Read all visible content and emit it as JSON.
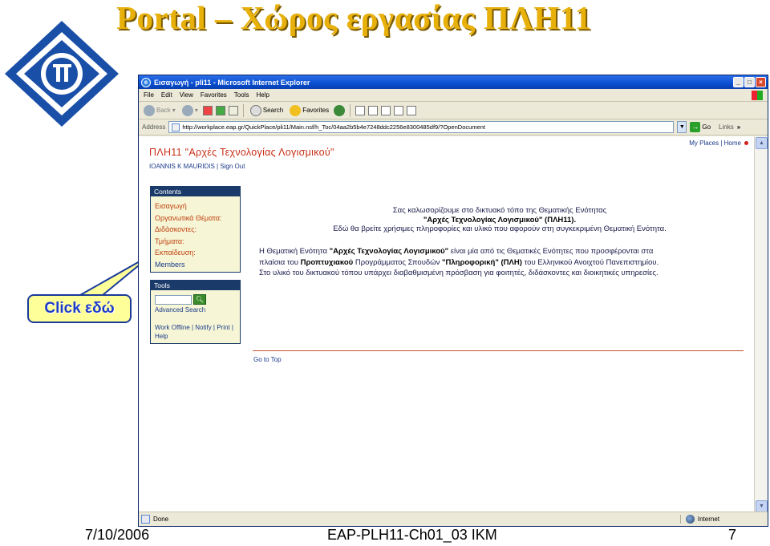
{
  "slide": {
    "title": "Portal – Χώρος εργασίας ΠΛΗ11",
    "callout": "Click εδώ",
    "footer_date": "7/10/2006",
    "footer_center": "EAP-PLH11-Ch01_03 IKM",
    "footer_page": "7"
  },
  "browser": {
    "window_title": "Εισαγωγή - pli11 - Microsoft Internet Explorer",
    "menu": [
      "File",
      "Edit",
      "View",
      "Favorites",
      "Tools",
      "Help"
    ],
    "toolbar": {
      "back": "Back",
      "search": "Search",
      "favorites": "Favorites"
    },
    "address_label": "Address",
    "address_value": "http://workplace.eap.gr/QuickPlace/pli11/Main.nsf/h_Toc/04aa2b5b4e7248ddc2256e8300485df9/?OpenDocument",
    "go_label": "Go",
    "links_label": "Links",
    "status_text": "Done",
    "status_zone": "Internet"
  },
  "page": {
    "my_places": "My Places | Home",
    "qp_title": "ΠΛΗ11 \"Αρχές Τεχνολογίας Λογισμικού\"",
    "user_line": "IOANNIS K MAURIDIS | Sign Out",
    "contents_header": "Contents",
    "contents_items": [
      "Εισαγωγή",
      "Οργανωτικά Θέματα:",
      "Διδάσκοντες:",
      "Τμήματα:",
      "Εκπαίδευση:",
      "Members"
    ],
    "tools_header": "Tools",
    "advanced_search": "Advanced Search",
    "tool_links_1": "Work Offline | Notify | Print |",
    "tool_links_2": "Help",
    "welcome_1": "Σας καλωσορίζουμε στο δικτυακό τόπο της Θεματικής Ενότητας",
    "welcome_2": "\"Αρχές Τεχνολογίας Λογισμικού\" (ΠΛΗ11).",
    "welcome_3": "Εδώ θα βρείτε χρήσιμες πληροφορίες και υλικό που αφορούν στη συγκεκριμένη Θεματική Ενότητα.",
    "intro_a": "Η Θεματική Ενότητα ",
    "intro_b": "\"Αρχές Τεχνολογίας Λογισμικού\"",
    "intro_c": " είναι μία από τις Θεματικές Ενότητες που προσφέρονται στα",
    "intro_d": "πλαίσια του ",
    "intro_e": "Προπτυχιακού",
    "intro_f": " Προγράμματος Σπουδών ",
    "intro_g": "\"Πληροφορική\" (ΠΛΗ)",
    "intro_h": " του Ελληνικού Ανοιχτού Πανεπιστημίου.",
    "intro_i": "Στο υλικό του δικτυακού τόπου υπάρχει διαβαθμισμένη πρόσβαση για φοιτητές, διδάσκοντες και διοικητικές υπηρεσίες.",
    "go_top": "Go to Top"
  },
  "colors": {
    "title_gold": "#e8b00a",
    "accent_red": "#c83018",
    "panel_blue": "#1a3a6a",
    "callout_fill": "#ffff99"
  }
}
